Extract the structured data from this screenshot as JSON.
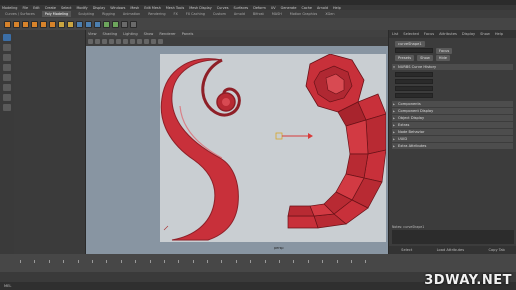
{
  "menubar": {
    "items": [
      "Modeling",
      "File",
      "Edit",
      "Create",
      "Select",
      "Modify",
      "Display",
      "Windows",
      "Mesh",
      "Edit Mesh",
      "Mesh Tools",
      "Mesh Display",
      "Curves",
      "Surfaces",
      "Deform",
      "UV",
      "Generate",
      "Cache",
      "Arnold",
      "Help"
    ]
  },
  "workspace_label": "Workspace",
  "shelf": {
    "active_tab": "Poly Modeling",
    "tabs": [
      "Curves / Surfaces",
      "Poly Modeling",
      "Sculpting",
      "Rigging",
      "Animation",
      "Rendering",
      "FX",
      "FX Caching",
      "Custom",
      "Arnold",
      "Bifrost",
      "MASH",
      "Motion Graphics",
      "XGen"
    ]
  },
  "viewport": {
    "menus": [
      "View",
      "Shading",
      "Lighting",
      "Show",
      "Renderer",
      "Panels"
    ],
    "camera_label": "persp",
    "colors": {
      "mesh": "#c8303a",
      "mesh_dark": "#8e1f27",
      "edge": "#6a1218",
      "background": "#c9ced2"
    }
  },
  "attribute_editor": {
    "tabs": [
      "List",
      "Selected",
      "Focus",
      "Attributes",
      "Display",
      "Show",
      "Help"
    ],
    "node_label": "curveShape1",
    "focus_button": "Focus",
    "presets_button": "Presets",
    "show_button": "Show",
    "hide_button": "Hide",
    "section_open": "NURBS Curve History",
    "sections": [
      "Components",
      "Component Display",
      "Object Display",
      "Extras",
      "Node Behavior",
      "UUID",
      "Extra Attributes"
    ],
    "notes_label": "Notes: curveShape1",
    "footer": [
      "Select",
      "Load Attributes",
      "Copy Tab"
    ]
  },
  "timeline": {
    "start": "1",
    "end": "120"
  },
  "command_line": {
    "lang": "MEL"
  },
  "watermark": "3DWAY.NET"
}
